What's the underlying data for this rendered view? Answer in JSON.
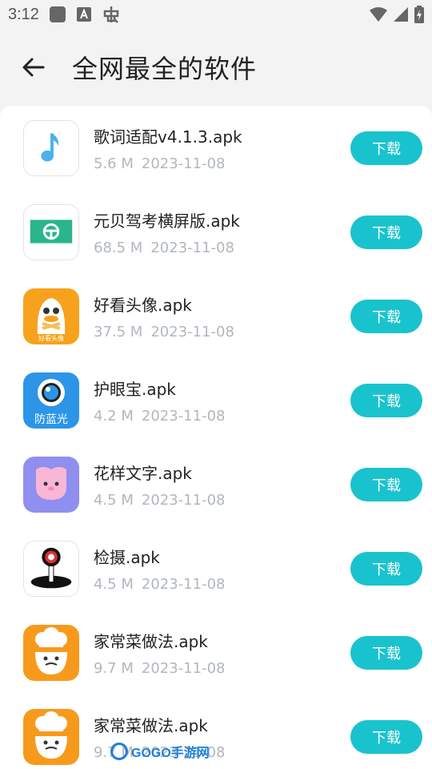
{
  "status_bar": {
    "time": "3:12",
    "left_icons": [
      "square-notification-icon",
      "font-a-icon",
      "bug-icon"
    ],
    "right_icons": [
      "wifi-icon",
      "signal-icon",
      "battery-charging-icon"
    ]
  },
  "toolbar": {
    "title": "全网最全的软件"
  },
  "apps": [
    {
      "name": "歌词适配v4.1.3.apk",
      "size": "5.6 M",
      "date": "2023-11-08",
      "button": "下载",
      "icon": "music-note-icon"
    },
    {
      "name": "元贝驾考横屏版.apk",
      "size": "68.5 M",
      "date": "2023-11-08",
      "button": "下载",
      "icon": "steering-wheel-icon"
    },
    {
      "name": "好看头像.apk",
      "size": "37.5 M",
      "date": "2023-11-08",
      "button": "下载",
      "icon": "duck-avatar-icon",
      "icon_text": "好看头像"
    },
    {
      "name": "护眼宝.apk",
      "size": "4.2 M",
      "date": "2023-11-08",
      "button": "下载",
      "icon": "eye-icon",
      "icon_text": "防蓝光"
    },
    {
      "name": "花样文字.apk",
      "size": "4.5 M",
      "date": "2023-11-08",
      "button": "下载",
      "icon": "flower-face-icon"
    },
    {
      "name": "检摄.apk",
      "size": "4.5 M",
      "date": "2023-11-08",
      "button": "下载",
      "icon": "camera-probe-icon"
    },
    {
      "name": "家常菜做法.apk",
      "size": "9.7 M",
      "date": "2023-11-08",
      "button": "下载",
      "icon": "chef-icon"
    },
    {
      "name": "家常菜做法.apk",
      "size": "9.7 M",
      "date": "2023-11-08",
      "button": "下载",
      "icon": "chef-icon"
    }
  ],
  "watermark": {
    "text": "GOGO手游网"
  },
  "colors": {
    "accent": "#19c3cd",
    "meta_text": "#b1b7be",
    "background": "#f3f3f3"
  }
}
